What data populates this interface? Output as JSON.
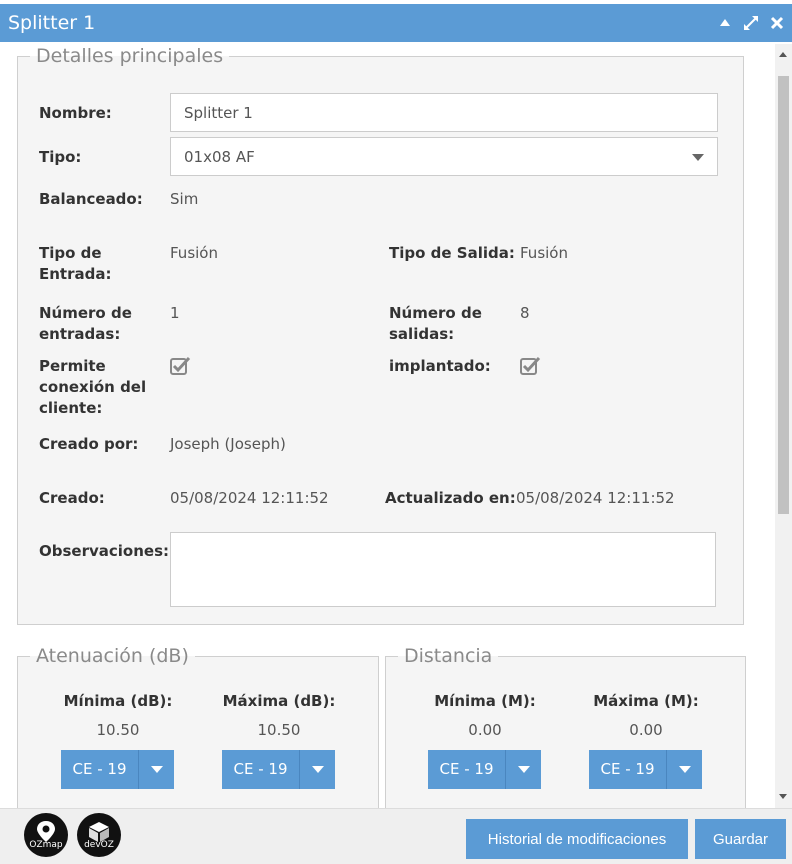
{
  "window": {
    "title": "Splitter 1"
  },
  "main_section": {
    "legend": "Detalles principales",
    "nombre": {
      "label": "Nombre:",
      "value": "Splitter 1"
    },
    "tipo": {
      "label": "Tipo:",
      "selected": "01x08 AF"
    },
    "balanceado": {
      "label": "Balanceado:",
      "value": "Sim"
    },
    "tipo_entrada": {
      "label_line1": "Tipo de",
      "label_line2": "Entrada:",
      "value": "Fusión"
    },
    "tipo_salida": {
      "label": "Tipo de Salida:",
      "value": "Fusión"
    },
    "num_entradas": {
      "label_line1": "Número de",
      "label_line2": "entradas:",
      "value": "1"
    },
    "num_salidas": {
      "label_line1": "Número de",
      "label_line2": "salidas:",
      "value": "8"
    },
    "permite_conexion": {
      "label_line1": "Permite",
      "label_line2": "conexión del",
      "label_line3": "cliente:",
      "checked": true
    },
    "implantado": {
      "label": "implantado:",
      "checked": true
    },
    "creado_por": {
      "label": "Creado por:",
      "value": "Joseph (Joseph)"
    },
    "creado": {
      "label": "Creado:",
      "value": "05/08/2024 12:11:52"
    },
    "actualizado": {
      "label": "Actualizado en:",
      "value": "05/08/2024 12:11:52"
    },
    "observaciones": {
      "label": "Observaciones:",
      "value": ""
    }
  },
  "atenuacion": {
    "legend": "Atenuación (dB)",
    "minima": {
      "label": "Mínima (dB):",
      "value": "10.50",
      "button": "CE - 19"
    },
    "maxima": {
      "label": "Máxima (dB):",
      "value": "10.50",
      "button": "CE - 19"
    }
  },
  "distancia": {
    "legend": "Distancia",
    "minima": {
      "label": "Mínima (M):",
      "value": "0.00",
      "button": "CE - 19"
    },
    "maxima": {
      "label": "Máxima (M):",
      "value": "0.00",
      "button": "CE - 19"
    }
  },
  "footer": {
    "logo_ozmap": "OZmap",
    "logo_devoz": "devOZ",
    "historial_button": "Historial de modificaciones",
    "guardar_button": "Guardar"
  },
  "colors": {
    "accent": "#5b9bd5",
    "panel": "#f5f5f5"
  },
  "icons": [
    "collapse-icon",
    "expand-icon",
    "close-icon",
    "checkbox-checked-icon",
    "map-pin-icon",
    "box-icon"
  ]
}
